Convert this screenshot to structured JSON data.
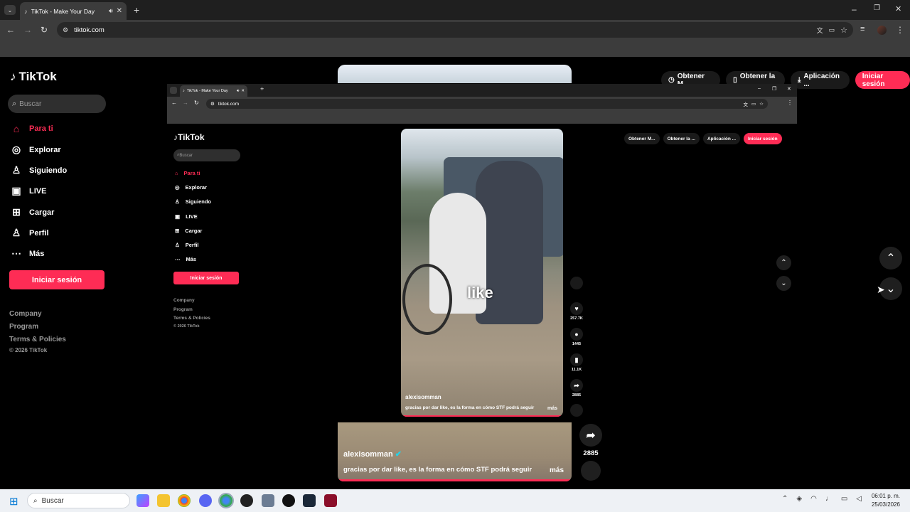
{
  "browser": {
    "tab_title": "TikTok - Make Your Day",
    "url": "tiktok.com"
  },
  "sidebar": {
    "logo": "TikTok",
    "search_placeholder": "Buscar",
    "items": [
      {
        "label": "Para ti",
        "icon": "home-icon",
        "active": true
      },
      {
        "label": "Explorar",
        "icon": "compass-icon"
      },
      {
        "label": "Siguiendo",
        "icon": "following-icon"
      },
      {
        "label": "LIVE",
        "icon": "live-icon"
      },
      {
        "label": "Cargar",
        "icon": "upload-icon"
      },
      {
        "label": "Perfil",
        "icon": "profile-icon"
      },
      {
        "label": "Más",
        "icon": "more-icon"
      }
    ],
    "login_label": "Iniciar sesión",
    "footer": [
      "Company",
      "Program",
      "Terms & Policies",
      "© 2026 TikTok"
    ]
  },
  "header_actions": {
    "obtener_m": "Obtener M...",
    "obtener_la": "Obtener la ...",
    "aplicacion": "Aplicación ...",
    "login": "Iniciar sesión"
  },
  "inner": {
    "tab_title": "TikTok - Make Your Day",
    "url": "tiktok.com",
    "logo": "TikTok",
    "search_placeholder": "Buscar",
    "items": [
      "Para ti",
      "Explorar",
      "Siguiendo",
      "LIVE",
      "Cargar",
      "Perfil",
      "Más"
    ],
    "login_label": "Iniciar sesión",
    "footer": [
      "Company",
      "Program",
      "Terms & Policies",
      "© 2026 TikTok"
    ],
    "header": [
      "Obtener M...",
      "Obtener la ...",
      "Aplicación ...",
      "Iniciar sesión"
    ],
    "video": {
      "overlay": "like",
      "author": "alexisomman",
      "caption": "gracias por dar like, es la forma en cómo STF podrá seguir",
      "more": "más",
      "likes": "257.7K",
      "comments": "1445",
      "saves": "11.1K",
      "shares": "2885"
    }
  },
  "video": {
    "author": "alexisomman",
    "caption": "gracias por dar like, es la forma en cómo STF podrá seguir",
    "more": "más",
    "shares": "2885"
  },
  "taskbar": {
    "search_placeholder": "Buscar",
    "time": "06:01 p. m.",
    "date": "25/03/2026"
  }
}
